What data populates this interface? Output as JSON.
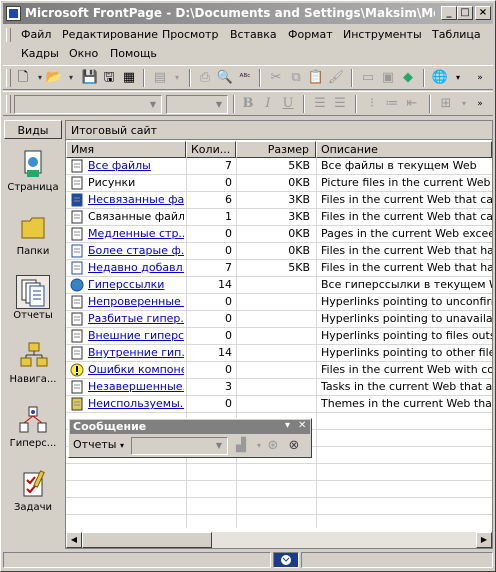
{
  "window": {
    "title": "Microsoft FrontPage - D:\\Documents and Settings\\Maksim\\Мои докум...",
    "minimize": "_",
    "maximize": "□",
    "close": "×"
  },
  "menu": {
    "items": [
      "Файл",
      "Редактирование",
      "Просмотр",
      "Вставка",
      "Формат",
      "Инструменты",
      "Таблица",
      "Кадры",
      "Окно",
      "Помощь"
    ]
  },
  "views": {
    "header": "Виды",
    "items": [
      {
        "label": "Страница",
        "icon": "page-view-icon"
      },
      {
        "label": "Папки",
        "icon": "folder-icon"
      },
      {
        "label": "Отчеты",
        "icon": "reports-icon",
        "selected": true
      },
      {
        "label": "Навига...",
        "icon": "navigation-icon"
      },
      {
        "label": "Гиперс...",
        "icon": "hyperlinks-icon"
      },
      {
        "label": "Задачи",
        "icon": "tasks-icon"
      }
    ]
  },
  "report": {
    "title": "Итоговый сайт",
    "columns": [
      "Имя",
      "Коли...",
      "Размер",
      "Описание"
    ],
    "rows": [
      {
        "name": "Все файлы",
        "count": "7",
        "size": "5KB",
        "desc": "Все файлы в текущем Web",
        "link": true,
        "icon": "file-icon"
      },
      {
        "name": "Рисунки",
        "count": "0",
        "size": "0KB",
        "desc": "Picture files in the current Web (GIF",
        "link": false,
        "icon": "picture-icon"
      },
      {
        "name": "Несвязанные фай...",
        "count": "6",
        "size": "3KB",
        "desc": "Files in the current Web that cannot",
        "link": true,
        "icon": "unlinked-files-icon"
      },
      {
        "name": "Связанные файлы",
        "count": "1",
        "size": "3KB",
        "desc": "Files in the current Web that can be",
        "link": false,
        "icon": "linked-files-icon"
      },
      {
        "name": "Медленные стр...",
        "count": "0",
        "size": "0KB",
        "desc": "Pages in the current Web exceeding",
        "link": true,
        "icon": "slow-pages-icon"
      },
      {
        "name": "Более старые ф...",
        "count": "0",
        "size": "0KB",
        "desc": "Files in the current Web that have n",
        "link": true,
        "icon": "older-files-icon"
      },
      {
        "name": "Недавно добавл...",
        "count": "7",
        "size": "5KB",
        "desc": "Files in the current Web that have b",
        "link": true,
        "icon": "recent-files-icon"
      },
      {
        "name": "Гиперссылки",
        "count": "14",
        "size": "",
        "desc": "Все гиперссылки в текущем Web",
        "link": true,
        "icon": "globe-icon"
      },
      {
        "name": "Непроверенные ...",
        "count": "0",
        "size": "",
        "desc": "Hyperlinks pointing to unconfirmed t",
        "link": true,
        "icon": "unverified-link-icon"
      },
      {
        "name": "Разбитые гипер...",
        "count": "0",
        "size": "",
        "desc": "Hyperlinks pointing to unavailable ta",
        "link": true,
        "icon": "broken-link-icon"
      },
      {
        "name": "Внешние гиперс...",
        "count": "0",
        "size": "",
        "desc": "Hyperlinks pointing to files outside c",
        "link": true,
        "icon": "external-link-icon"
      },
      {
        "name": "Внутренние гип...",
        "count": "14",
        "size": "",
        "desc": "Hyperlinks pointing to other files wit",
        "link": true,
        "icon": "internal-link-icon"
      },
      {
        "name": "Ошибки компоне...",
        "count": "0",
        "size": "",
        "desc": "Files in the current Web with compo",
        "link": true,
        "icon": "component-error-icon"
      },
      {
        "name": "Незавершенные...",
        "count": "3",
        "size": "",
        "desc": "Tasks in the current Web that are n",
        "link": true,
        "icon": "tasks-icon"
      },
      {
        "name": "Неиспользуемы...",
        "count": "0",
        "size": "",
        "desc": "Themes in the current Web that are",
        "link": true,
        "icon": "themes-icon"
      }
    ]
  },
  "floating_toolbar": {
    "title": "Сообщение",
    "dropdown_label": "Отчеты"
  }
}
